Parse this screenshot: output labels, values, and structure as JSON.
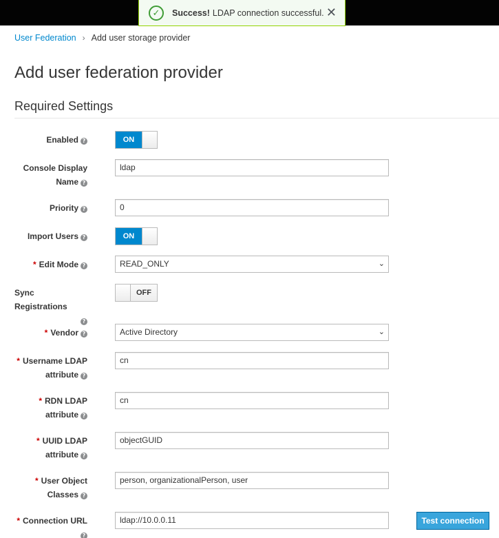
{
  "toast": {
    "strong": "Success!",
    "message": "LDAP connection successful.",
    "color": "#3f9c35"
  },
  "breadcrumb": {
    "parent": "User Federation",
    "separator": "›",
    "current": "Add user storage provider"
  },
  "page_title": "Add user federation provider",
  "section_title": "Required Settings",
  "help_glyph": "?",
  "required_marker": "*",
  "fields": {
    "enabled": {
      "label": "Enabled",
      "state": "ON"
    },
    "console_display_name": {
      "label_line1": "Console Display",
      "label_line2": "Name",
      "value": "ldap"
    },
    "priority": {
      "label": "Priority",
      "value": "0"
    },
    "import_users": {
      "label": "Import Users",
      "state": "ON"
    },
    "edit_mode": {
      "label": "Edit Mode",
      "value": "READ_ONLY"
    },
    "sync_registrations": {
      "label": "Sync Registrations",
      "state": "OFF"
    },
    "vendor": {
      "label": "Vendor",
      "value": "Active Directory"
    },
    "username_ldap": {
      "label_line1": "Username LDAP",
      "label_line2": "attribute",
      "value": "cn"
    },
    "rdn_ldap": {
      "label_line1": "RDN LDAP",
      "label_line2": "attribute",
      "value": "cn"
    },
    "uuid_ldap": {
      "label_line1": "UUID LDAP",
      "label_line2": "attribute",
      "value": "objectGUID"
    },
    "user_object_classes": {
      "label_line1": "User Object",
      "label_line2": "Classes",
      "value": "person, organizationalPerson, user"
    },
    "connection_url": {
      "label": "Connection URL",
      "value": "ldap://10.0.0.11"
    }
  },
  "buttons": {
    "test_connection": "Test connection"
  },
  "colors": {
    "accent": "#0088ce",
    "button": "#39a5dc",
    "required": "#cc0000"
  }
}
